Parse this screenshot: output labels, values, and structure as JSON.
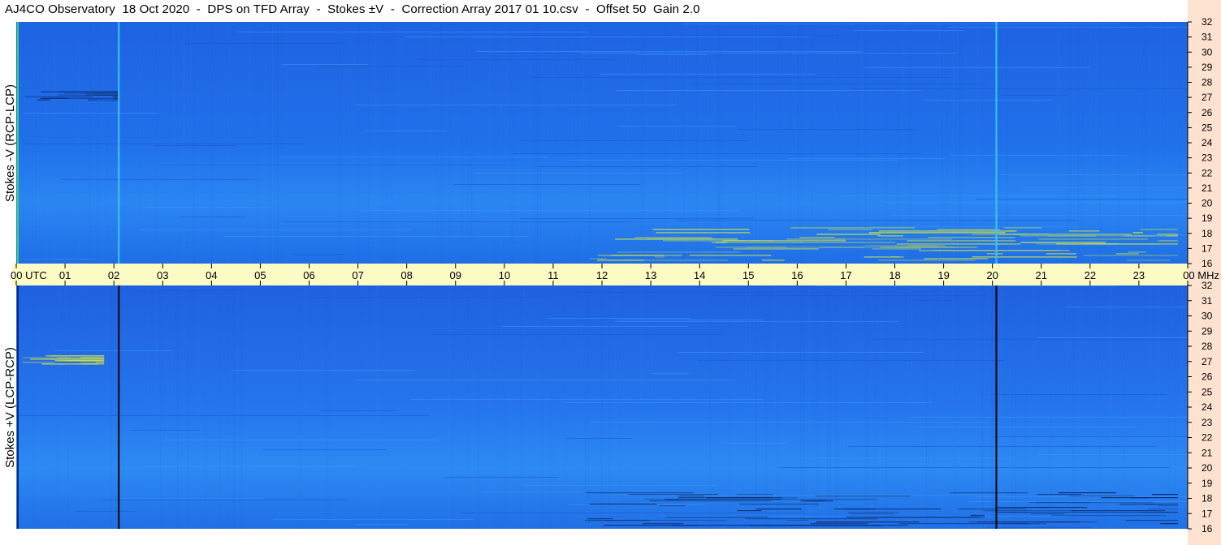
{
  "title": "AJ4CO Observatory  18 Oct 2020  -  DPS on TFD Array  -  Stokes ±V  -  Correction Array 2017 01 10.csv  -  Offset 50  Gain 2.0",
  "colors": {
    "background_blue": "#1f6be8",
    "band_light": "#2f8cf0",
    "time_band": "#fdfbc4",
    "right_strip": "#fde2cf"
  },
  "chart_data": {
    "type": "heatmap",
    "panels": [
      {
        "name": "top",
        "ylabel": "Stokes -V (RCP-LCP)",
        "y": {
          "min": 16,
          "max": 32,
          "ticks": [
            16,
            17,
            18,
            19,
            20,
            21,
            22,
            23,
            24,
            25,
            26,
            27,
            28,
            29,
            30,
            31,
            32
          ]
        },
        "features": [
          {
            "kind": "vertical_line",
            "time_utc": 2.1,
            "color": "#39c6ff"
          },
          {
            "kind": "vertical_line",
            "time_utc": 20.08,
            "color": "#39c6ff"
          },
          {
            "kind": "burst_region",
            "t_start": 11.6,
            "t_end": 23.8,
            "f_low": 16.2,
            "f_high": 18.4,
            "color": "#d8e83a"
          },
          {
            "kind": "burst_region",
            "t_start": 0.1,
            "t_end": 2.1,
            "f_low": 26.8,
            "f_high": 27.4,
            "color": "#0b2a6b"
          }
        ]
      },
      {
        "name": "bottom",
        "ylabel": "Stokes +V (LCP-RCP)",
        "y": {
          "min": 16,
          "max": 32,
          "ticks": [
            16,
            17,
            18,
            19,
            20,
            21,
            22,
            23,
            24,
            25,
            26,
            27,
            28,
            29,
            30,
            31,
            32
          ]
        },
        "features": [
          {
            "kind": "vertical_line",
            "time_utc": 2.1,
            "color": "#000000"
          },
          {
            "kind": "vertical_line",
            "time_utc": 20.08,
            "color": "#000000"
          },
          {
            "kind": "burst_region",
            "t_start": 0.1,
            "t_end": 1.8,
            "f_low": 26.8,
            "f_high": 27.4,
            "color": "#d8e83a"
          },
          {
            "kind": "burst_region",
            "t_start": 11.6,
            "t_end": 23.8,
            "f_low": 16.2,
            "f_high": 18.4,
            "color": "#0b2a6b"
          }
        ]
      }
    ],
    "x": {
      "unit": "UTC",
      "min": 0,
      "max": 24,
      "ticks": [
        "00",
        "01",
        "02",
        "03",
        "04",
        "05",
        "06",
        "07",
        "08",
        "09",
        "10",
        "11",
        "12",
        "13",
        "14",
        "15",
        "16",
        "17",
        "18",
        "19",
        "20",
        "21",
        "22",
        "23",
        "00"
      ],
      "first_suffix": "UTC",
      "last_suffix": "MHz"
    }
  }
}
